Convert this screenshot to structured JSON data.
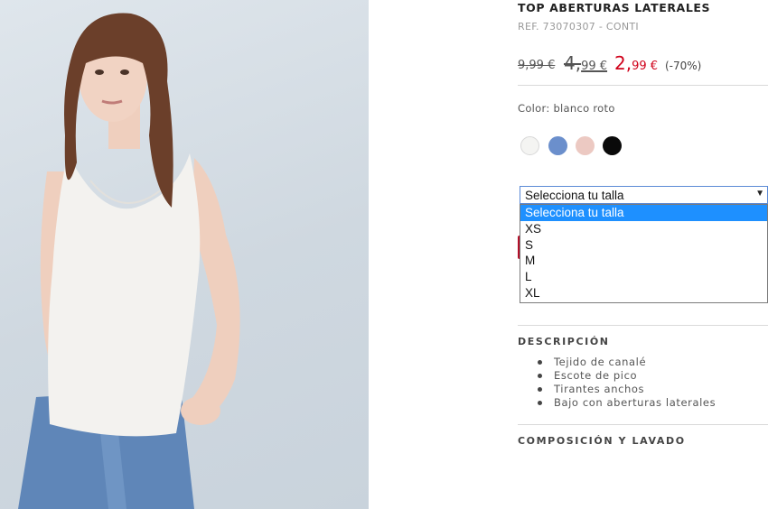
{
  "product": {
    "title": "TOP ABERTURAS LATERALES",
    "ref": "REF. 73070307 - CONTI",
    "prices": {
      "original": "9,99 €",
      "previous_int": "4,",
      "previous_dec": "99 €",
      "current_int": "2,",
      "current_dec": "99 €",
      "discount": "(-70%)"
    },
    "color_label": "Color: blanco roto",
    "swatches": [
      {
        "name": "blanco roto",
        "color": "#f4f4f2"
      },
      {
        "name": "azul",
        "color": "#6b8fcc"
      },
      {
        "name": "rosa",
        "color": "#ecc9c2"
      },
      {
        "name": "negro",
        "color": "#0a0a0a"
      }
    ]
  },
  "size_select": {
    "value": "Selecciona tu talla",
    "arrow": "▼",
    "options": [
      "Selecciona tu talla",
      "XS",
      "S",
      "M",
      "L",
      "XL"
    ]
  },
  "description": {
    "title": "DESCRIPCIÓN",
    "items": [
      "Tejido de canalé",
      "Escote de pico",
      "Tirantes anchos",
      "Bajo con aberturas laterales"
    ]
  },
  "composition": {
    "title": "COMPOSICIÓN Y LAVADO"
  },
  "colors": {
    "sale_red": "#d0021b",
    "select_highlight": "#1e90ff"
  }
}
